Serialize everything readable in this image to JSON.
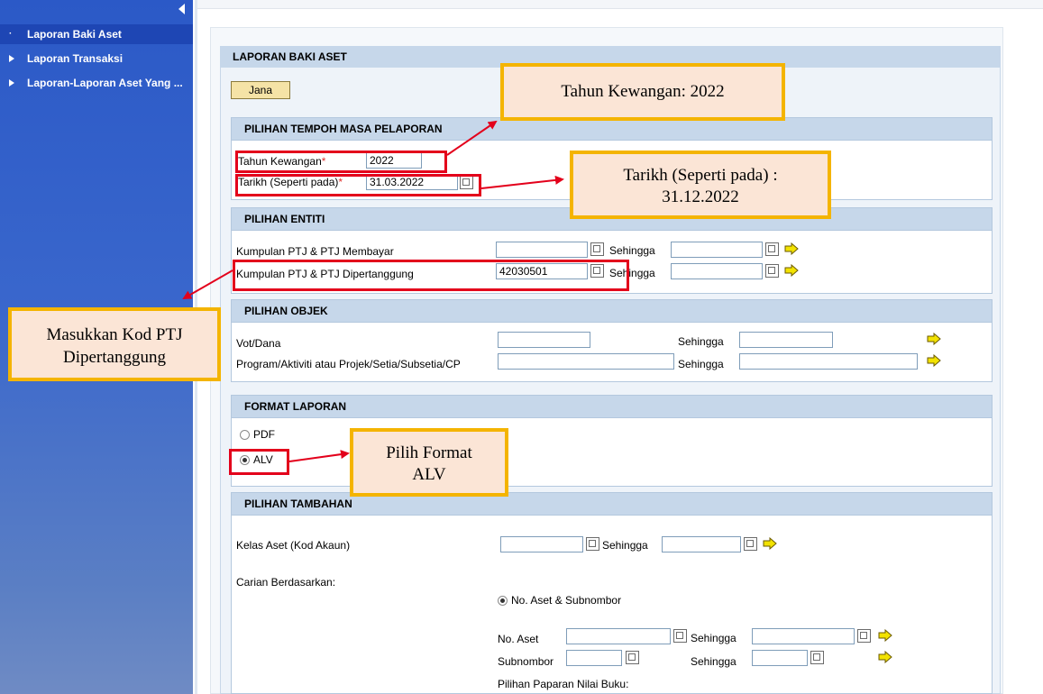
{
  "sidebar": {
    "items": [
      {
        "label": "Laporan Baki Aset",
        "marker": "·"
      },
      {
        "label": "Laporan Transaksi"
      },
      {
        "label": "Laporan-Laporan Aset Yang ..."
      }
    ]
  },
  "panel": {
    "title": "LAPORAN BAKI ASET",
    "jana_label": "Jana",
    "tempoh": {
      "title": "PILIHAN TEMPOH MASA PELAPORAN",
      "tahun_label": "Tahun Kewangan",
      "tahun_value": "2022",
      "tarikh_label": "Tarikh (Seperti pada)",
      "tarikh_value": "31.03.2022",
      "required_mark": "*"
    },
    "entiti": {
      "title": "PILIHAN ENTITI",
      "row1_label": "Kumpulan PTJ & PTJ Membayar",
      "row1_value": "",
      "row2_label": "Kumpulan PTJ & PTJ Dipertanggung",
      "row2_value": "42030501",
      "sehingga": "Sehingga"
    },
    "objek": {
      "title": "PILIHAN OBJEK",
      "row1_label": "Vot/Dana",
      "row2_label": "Program/Aktiviti atau Projek/Setia/Subsetia/CP",
      "sehingga": "Sehingga"
    },
    "format": {
      "title": "FORMAT LAPORAN",
      "opt_pdf": "PDF",
      "opt_alv": "ALV",
      "selected": "ALV"
    },
    "tambahan": {
      "title": "PILIHAN TAMBAHAN",
      "kelas_label": "Kelas Aset (Kod Akaun)",
      "sehingga": "Sehingga",
      "carian_label": "Carian Berdasarkan:",
      "opt_no_aset": "No. Aset & Subnombor",
      "no_aset_label": "No. Aset",
      "subnombor_label": "Subnombor",
      "paparan_label": "Pilihan Paparan Nilai Buku:"
    }
  },
  "annotations": {
    "c1": "Tahun Kewangan: 2022",
    "c2_line1": "Tarikh (Seperti pada) :",
    "c2_line2": "31.12.2022",
    "c3_line1": "Masukkan Kod PTJ",
    "c3_line2": "Dipertanggung",
    "c4_line1": "Pilih Format",
    "c4_line2": "ALV"
  },
  "colors": {
    "sidebar": "#2b59c7",
    "section_header": "#c6d7ea",
    "jana_button": "#f5e3a6",
    "callout_border": "#f4b400",
    "callout_fill": "#fbe5d6",
    "highlight": "#e3001b"
  },
  "icons": {
    "f4_help": "f4-help-icon",
    "next_arrow": "yellow-arrow-icon",
    "collapse": "collapse-left-icon"
  }
}
